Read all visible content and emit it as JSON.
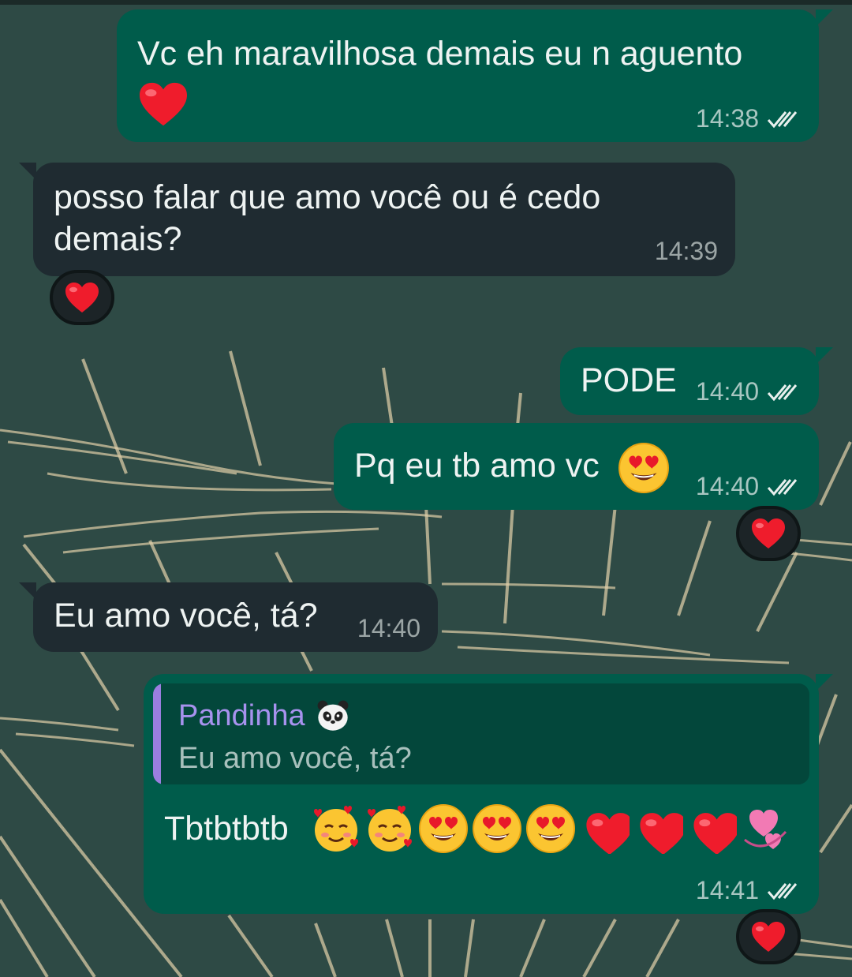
{
  "chat": {
    "messages": [
      {
        "direction": "outgoing",
        "text": "Vc eh maravilhosa demais eu n aguento",
        "emoji": "heart-emoji",
        "time": "14:38",
        "status": "read"
      },
      {
        "direction": "incoming",
        "text_line1": "posso falar que amo você ou é cedo",
        "text_line2": "demais?",
        "time": "14:39",
        "reaction": "heart-emoji"
      },
      {
        "direction": "outgoing",
        "text": "PODE",
        "time": "14:40",
        "status": "read"
      },
      {
        "direction": "outgoing",
        "text": "Pq eu tb amo vc",
        "emoji": "heart-eyes-emoji",
        "time": "14:40",
        "status": "read",
        "reaction": "heart-emoji"
      },
      {
        "direction": "incoming",
        "text": "Eu amo você, tá?",
        "time": "14:40"
      },
      {
        "direction": "outgoing",
        "reply_to": {
          "sender": "Pandinha",
          "sender_emoji": "panda-emoji",
          "text": "Eu amo você, tá?"
        },
        "text": "Tbtbtbtb",
        "emojis": [
          "smiling-face-with-hearts-emoji",
          "smiling-face-with-hearts-emoji",
          "heart-eyes-emoji",
          "heart-eyes-emoji",
          "heart-eyes-emoji",
          "heart-emoji",
          "heart-emoji",
          "heart-emoji",
          "revolving-hearts-emoji"
        ],
        "time": "14:41",
        "status": "read",
        "reaction": "heart-emoji"
      }
    ]
  },
  "colors": {
    "wallpaper": "#2c4541",
    "outgoing_bubble": "#005c4b",
    "incoming_bubble": "#1f2b31",
    "quote_accent": "#9b7ee0",
    "read_ticks": "#e9f0ee"
  }
}
